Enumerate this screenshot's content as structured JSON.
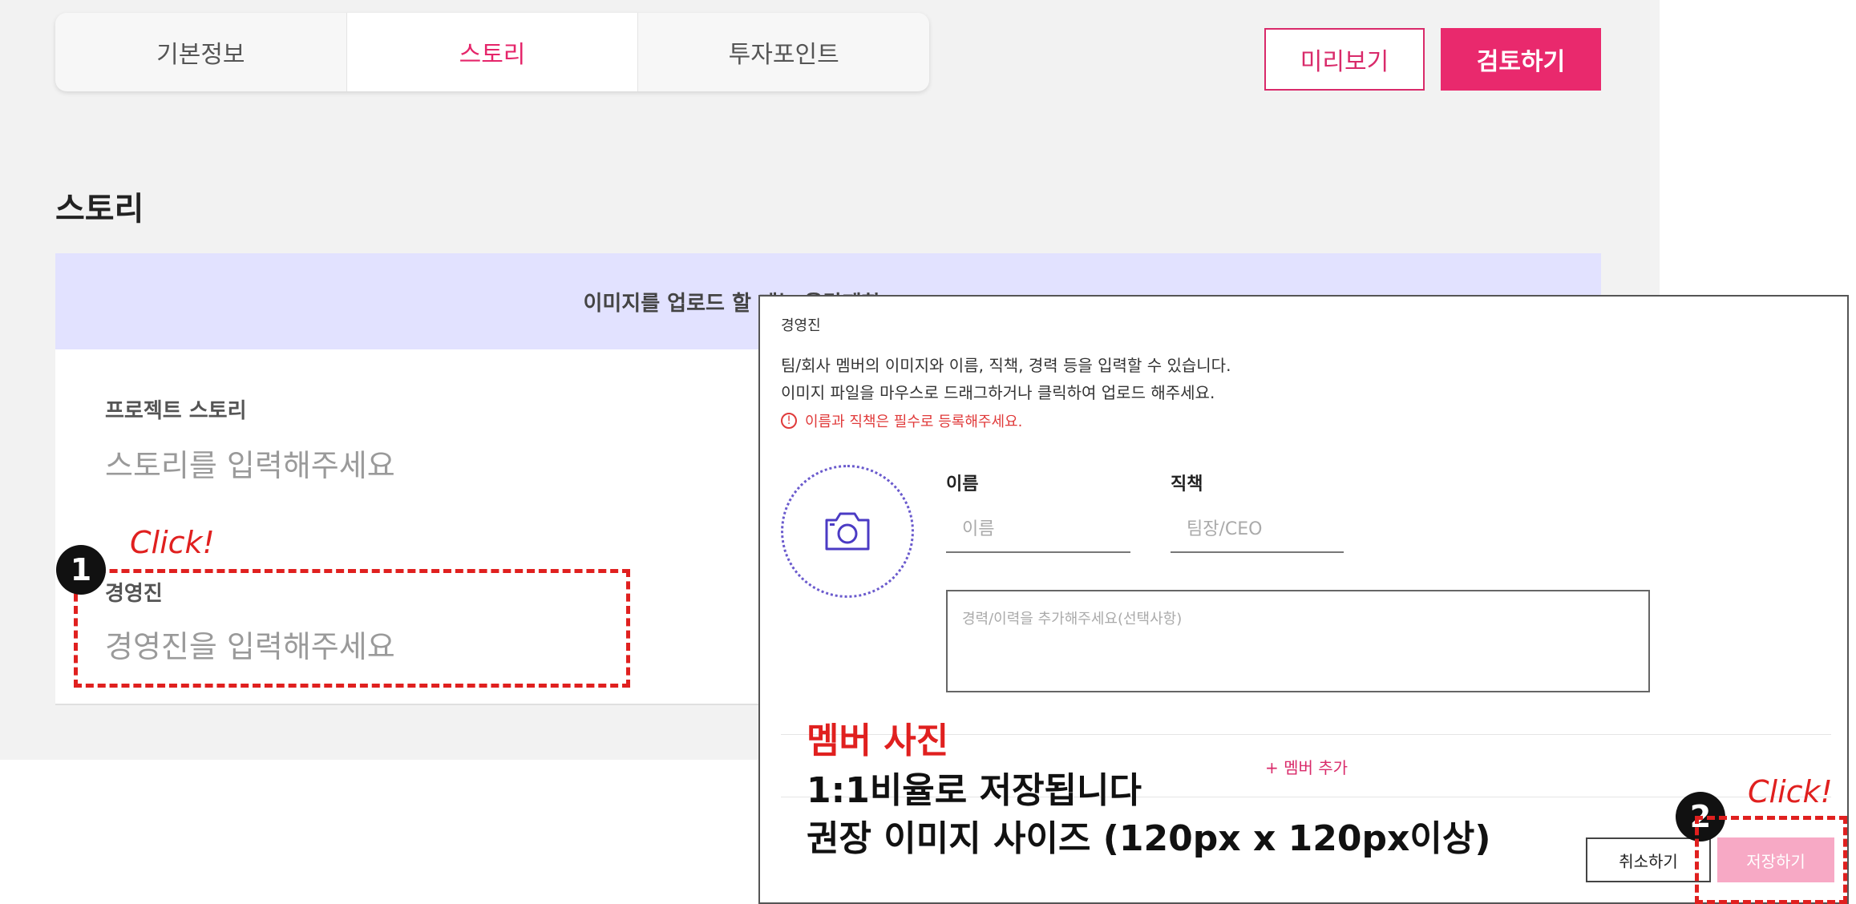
{
  "tabs": [
    "기본정보",
    "스토리",
    "투자포인트"
  ],
  "actions": {
    "preview": "미리보기",
    "review": "검토하기"
  },
  "section_title": "스토리",
  "notice": "이미지를 업로드 할 때는 용량제한",
  "cards": [
    {
      "label": "프로젝트 스토리",
      "placeholder": "스토리를 입력해주세요"
    },
    {
      "label": "경영진",
      "placeholder": "경영진을 입력해주세요"
    }
  ],
  "annotations": {
    "click": "Click!",
    "badge1": "1",
    "badge2": "2"
  },
  "modal": {
    "title": "경영진",
    "desc1": "팀/회사 멤버의 이미지와 이름, 직책, 경력 등을 입력할 수 있습니다.",
    "desc2": "이미지 파일을 마우스로 드래그하거나 클릭하여 업로드 해주세요.",
    "warning": "이름과 직책은 필수로 등록해주세요.",
    "name_label": "이름",
    "name_placeholder": "이름",
    "position_label": "직책",
    "position_placeholder": "팀장/CEO",
    "career_placeholder": "경력/이력을 추가해주세요(선택사항)",
    "add_member": "+ 멤버 추가",
    "cancel": "취소하기",
    "save": "저장하기"
  },
  "overlay": {
    "heading": "멤버 사진",
    "line1": "1:1비율로 저장됩니다",
    "line2": "권장 이미지 사이즈 (120px x 120px이상)"
  },
  "colors": {
    "accent": "#e9296d",
    "annotation": "#e0201f",
    "notice_bg": "#e2e2ff",
    "camera": "#4b3bc4"
  },
  "icons": [
    "camera-icon",
    "warning-circle-icon"
  ]
}
